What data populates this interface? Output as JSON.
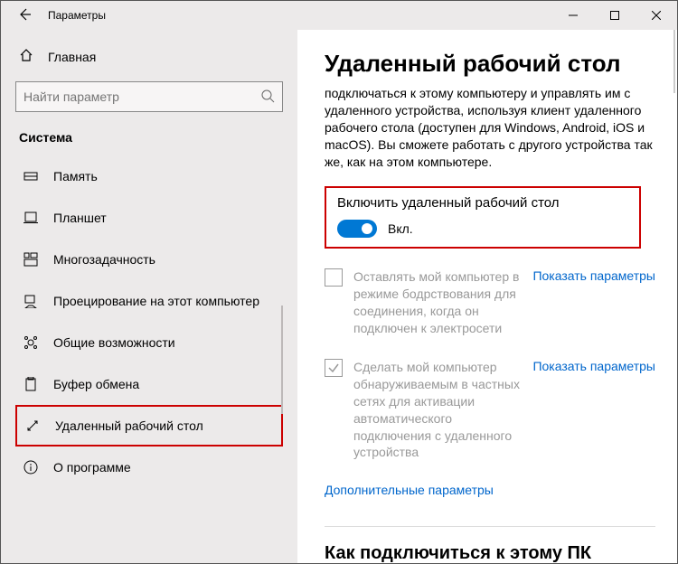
{
  "titlebar": {
    "title": "Параметры"
  },
  "sidebar": {
    "home": "Главная",
    "search_placeholder": "Найти параметр",
    "section": "Система",
    "items": [
      {
        "label": "Память"
      },
      {
        "label": "Планшет"
      },
      {
        "label": "Многозадачность"
      },
      {
        "label": "Проецирование на этот компьютер"
      },
      {
        "label": "Общие возможности"
      },
      {
        "label": "Буфер обмена"
      },
      {
        "label": "Удаленный рабочий стол"
      },
      {
        "label": "О программе"
      }
    ]
  },
  "content": {
    "title": "Удаленный рабочий стол",
    "description": "подключаться к этому компьютеру и управлять им с удаленного устройства, используя клиент удаленного рабочего стола (доступен для Windows, Android, iOS и macOS). Вы сможете работать с другого устройства так же, как на этом компьютере.",
    "toggle": {
      "label": "Включить удаленный рабочий стол",
      "state": "Вкл."
    },
    "settings": [
      {
        "text": "Оставлять мой компьютер в режиме бодрствования для соединения, когда он подключен к электросети",
        "checked": false,
        "link": "Показать параметры"
      },
      {
        "text": "Сделать мой компьютер обнаруживаемым в частных сетях для активации автоматического подключения с удаленного устройства",
        "checked": true,
        "link": "Показать параметры"
      }
    ],
    "advanced_link": "Дополнительные параметры",
    "connect_heading": "Как подключиться к этому ПК"
  }
}
